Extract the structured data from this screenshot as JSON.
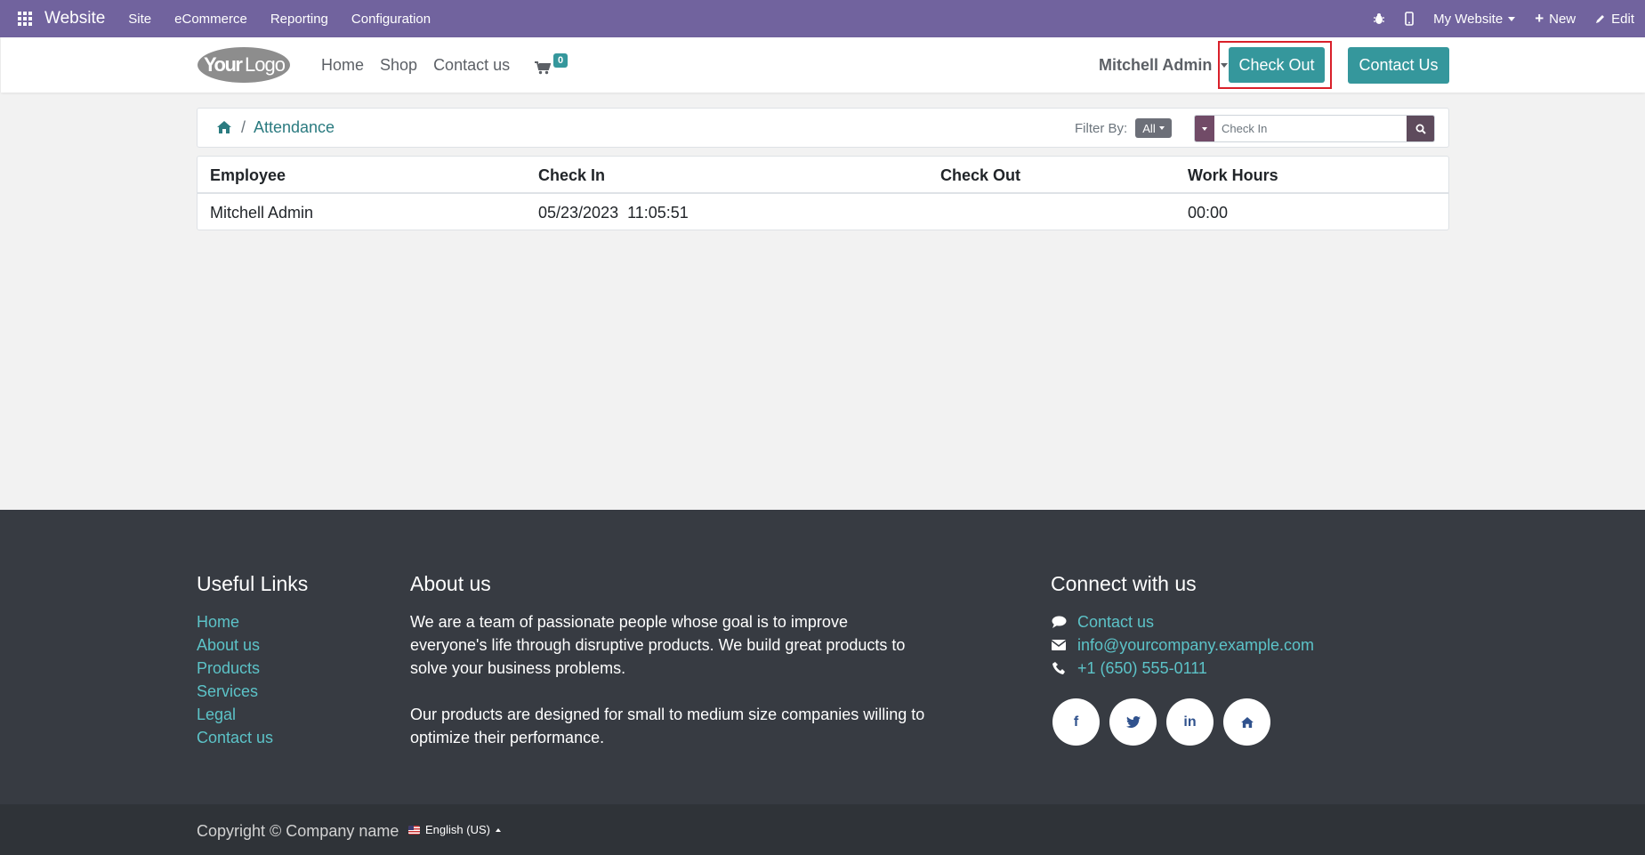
{
  "topbar": {
    "app_name": "Website",
    "menus": [
      "Site",
      "eCommerce",
      "Reporting",
      "Configuration"
    ],
    "my_website": "My Website",
    "new_label": "New",
    "edit_label": "Edit",
    "bg_color": "#71639e"
  },
  "header": {
    "logo_text": "YourLogo",
    "nav": [
      "Home",
      "Shop",
      "Contact us"
    ],
    "cart_count": "0",
    "user_name": "Mitchell Admin",
    "checkout_button": "Check Out",
    "contact_button": "Contact Us",
    "accent_color": "#35979c"
  },
  "breadcrumb": {
    "current": "Attendance",
    "filter_label": "Filter By:",
    "filter_value": "All",
    "search_placeholder": "Check In"
  },
  "table": {
    "columns": [
      "Employee",
      "Check In",
      "Check Out",
      "Work Hours"
    ],
    "rows": [
      {
        "employee": "Mitchell Admin",
        "check_in": "05/23/2023  11:05:51",
        "check_out": "",
        "work_hours": "00:00"
      }
    ]
  },
  "footer": {
    "useful_links_title": "Useful Links",
    "useful_links": [
      "Home",
      "About us",
      "Products",
      "Services",
      "Legal",
      "Contact us"
    ],
    "about_title": "About us",
    "about_p1": "We are a team of passionate people whose goal is to improve everyone's life through disruptive products. We build great products to solve your business problems.",
    "about_p2": "Our products are designed for small to medium size companies willing to optimize their performance.",
    "connect_title": "Connect with us",
    "contact_link": "Contact us",
    "email": "info@yourcompany.example.com",
    "phone": "+1 (650) 555-0111",
    "socials": [
      "facebook-icon",
      "twitter-icon",
      "linkedin-icon",
      "home-icon"
    ]
  },
  "copyright": {
    "text": "Copyright © Company name",
    "language": "English (US)"
  }
}
